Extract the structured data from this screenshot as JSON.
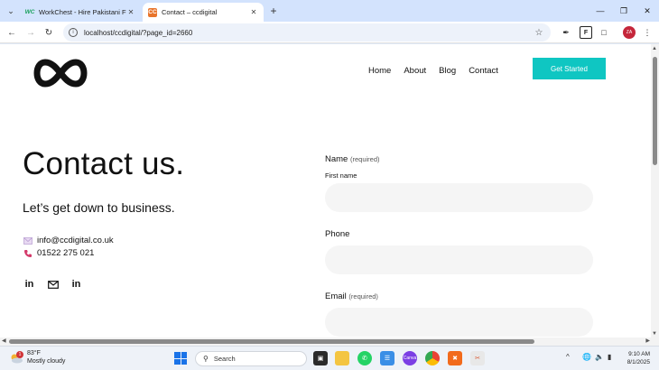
{
  "browser": {
    "tabs": [
      {
        "title": "WorkChest - Hire Pakistani Free",
        "favicon": "workchest-icon",
        "active": false
      },
      {
        "title": "Contact – ccdigital",
        "favicon": "ccdigital-icon",
        "active": true
      }
    ],
    "url": "localhost/ccdigital/?page_id=2660"
  },
  "site": {
    "nav": {
      "home": "Home",
      "about": "About",
      "blog": "Blog",
      "contact": "Contact"
    },
    "cta": "Get Started",
    "brand_color": "#0fc6c2"
  },
  "contact": {
    "heading": "Contact us.",
    "subheading": "Let’s get down to business.",
    "email": "info@ccdigital.co.uk",
    "phone": "01522 275 021",
    "socials": [
      "linkedin-icon",
      "mail-icon",
      "linkedin-icon"
    ]
  },
  "form": {
    "name_label": "Name",
    "name_required": "(required)",
    "first_name_label": "First name",
    "phone_label": "Phone",
    "email_label": "Email",
    "email_required": "(required)"
  },
  "taskbar": {
    "weather_temp": "83°F",
    "weather_desc": "Mostly cloudy",
    "weather_badge": "1",
    "search_placeholder": "Search",
    "time": "9:10 AM",
    "date": "8/1/2025"
  }
}
